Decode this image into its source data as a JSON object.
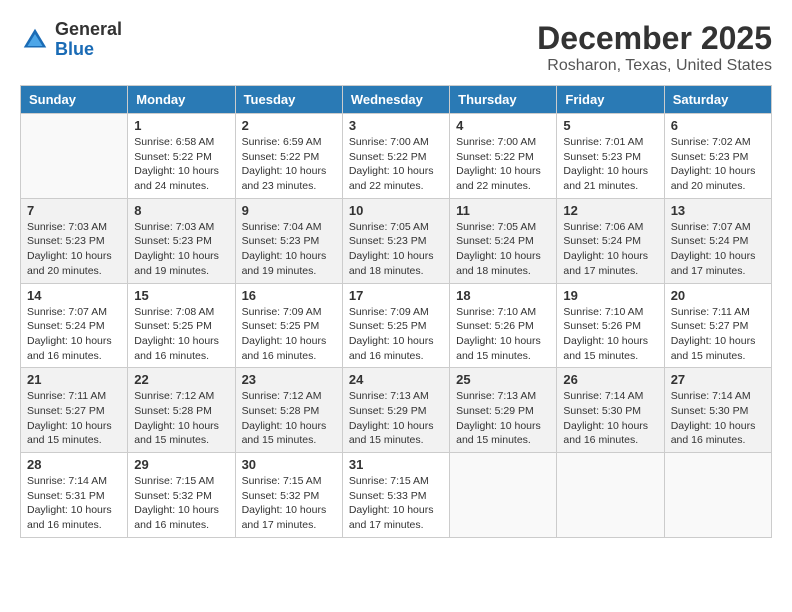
{
  "logo": {
    "general": "General",
    "blue": "Blue"
  },
  "title": "December 2025",
  "location": "Rosharon, Texas, United States",
  "headers": [
    "Sunday",
    "Monday",
    "Tuesday",
    "Wednesday",
    "Thursday",
    "Friday",
    "Saturday"
  ],
  "weeks": [
    [
      {
        "day": "",
        "sunrise": "",
        "sunset": "",
        "daylight": ""
      },
      {
        "day": "1",
        "sunrise": "Sunrise: 6:58 AM",
        "sunset": "Sunset: 5:22 PM",
        "daylight": "Daylight: 10 hours and 24 minutes."
      },
      {
        "day": "2",
        "sunrise": "Sunrise: 6:59 AM",
        "sunset": "Sunset: 5:22 PM",
        "daylight": "Daylight: 10 hours and 23 minutes."
      },
      {
        "day": "3",
        "sunrise": "Sunrise: 7:00 AM",
        "sunset": "Sunset: 5:22 PM",
        "daylight": "Daylight: 10 hours and 22 minutes."
      },
      {
        "day": "4",
        "sunrise": "Sunrise: 7:00 AM",
        "sunset": "Sunset: 5:22 PM",
        "daylight": "Daylight: 10 hours and 22 minutes."
      },
      {
        "day": "5",
        "sunrise": "Sunrise: 7:01 AM",
        "sunset": "Sunset: 5:23 PM",
        "daylight": "Daylight: 10 hours and 21 minutes."
      },
      {
        "day": "6",
        "sunrise": "Sunrise: 7:02 AM",
        "sunset": "Sunset: 5:23 PM",
        "daylight": "Daylight: 10 hours and 20 minutes."
      }
    ],
    [
      {
        "day": "7",
        "sunrise": "Sunrise: 7:03 AM",
        "sunset": "Sunset: 5:23 PM",
        "daylight": "Daylight: 10 hours and 20 minutes."
      },
      {
        "day": "8",
        "sunrise": "Sunrise: 7:03 AM",
        "sunset": "Sunset: 5:23 PM",
        "daylight": "Daylight: 10 hours and 19 minutes."
      },
      {
        "day": "9",
        "sunrise": "Sunrise: 7:04 AM",
        "sunset": "Sunset: 5:23 PM",
        "daylight": "Daylight: 10 hours and 19 minutes."
      },
      {
        "day": "10",
        "sunrise": "Sunrise: 7:05 AM",
        "sunset": "Sunset: 5:23 PM",
        "daylight": "Daylight: 10 hours and 18 minutes."
      },
      {
        "day": "11",
        "sunrise": "Sunrise: 7:05 AM",
        "sunset": "Sunset: 5:24 PM",
        "daylight": "Daylight: 10 hours and 18 minutes."
      },
      {
        "day": "12",
        "sunrise": "Sunrise: 7:06 AM",
        "sunset": "Sunset: 5:24 PM",
        "daylight": "Daylight: 10 hours and 17 minutes."
      },
      {
        "day": "13",
        "sunrise": "Sunrise: 7:07 AM",
        "sunset": "Sunset: 5:24 PM",
        "daylight": "Daylight: 10 hours and 17 minutes."
      }
    ],
    [
      {
        "day": "14",
        "sunrise": "Sunrise: 7:07 AM",
        "sunset": "Sunset: 5:24 PM",
        "daylight": "Daylight: 10 hours and 16 minutes."
      },
      {
        "day": "15",
        "sunrise": "Sunrise: 7:08 AM",
        "sunset": "Sunset: 5:25 PM",
        "daylight": "Daylight: 10 hours and 16 minutes."
      },
      {
        "day": "16",
        "sunrise": "Sunrise: 7:09 AM",
        "sunset": "Sunset: 5:25 PM",
        "daylight": "Daylight: 10 hours and 16 minutes."
      },
      {
        "day": "17",
        "sunrise": "Sunrise: 7:09 AM",
        "sunset": "Sunset: 5:25 PM",
        "daylight": "Daylight: 10 hours and 16 minutes."
      },
      {
        "day": "18",
        "sunrise": "Sunrise: 7:10 AM",
        "sunset": "Sunset: 5:26 PM",
        "daylight": "Daylight: 10 hours and 15 minutes."
      },
      {
        "day": "19",
        "sunrise": "Sunrise: 7:10 AM",
        "sunset": "Sunset: 5:26 PM",
        "daylight": "Daylight: 10 hours and 15 minutes."
      },
      {
        "day": "20",
        "sunrise": "Sunrise: 7:11 AM",
        "sunset": "Sunset: 5:27 PM",
        "daylight": "Daylight: 10 hours and 15 minutes."
      }
    ],
    [
      {
        "day": "21",
        "sunrise": "Sunrise: 7:11 AM",
        "sunset": "Sunset: 5:27 PM",
        "daylight": "Daylight: 10 hours and 15 minutes."
      },
      {
        "day": "22",
        "sunrise": "Sunrise: 7:12 AM",
        "sunset": "Sunset: 5:28 PM",
        "daylight": "Daylight: 10 hours and 15 minutes."
      },
      {
        "day": "23",
        "sunrise": "Sunrise: 7:12 AM",
        "sunset": "Sunset: 5:28 PM",
        "daylight": "Daylight: 10 hours and 15 minutes."
      },
      {
        "day": "24",
        "sunrise": "Sunrise: 7:13 AM",
        "sunset": "Sunset: 5:29 PM",
        "daylight": "Daylight: 10 hours and 15 minutes."
      },
      {
        "day": "25",
        "sunrise": "Sunrise: 7:13 AM",
        "sunset": "Sunset: 5:29 PM",
        "daylight": "Daylight: 10 hours and 15 minutes."
      },
      {
        "day": "26",
        "sunrise": "Sunrise: 7:14 AM",
        "sunset": "Sunset: 5:30 PM",
        "daylight": "Daylight: 10 hours and 16 minutes."
      },
      {
        "day": "27",
        "sunrise": "Sunrise: 7:14 AM",
        "sunset": "Sunset: 5:30 PM",
        "daylight": "Daylight: 10 hours and 16 minutes."
      }
    ],
    [
      {
        "day": "28",
        "sunrise": "Sunrise: 7:14 AM",
        "sunset": "Sunset: 5:31 PM",
        "daylight": "Daylight: 10 hours and 16 minutes."
      },
      {
        "day": "29",
        "sunrise": "Sunrise: 7:15 AM",
        "sunset": "Sunset: 5:32 PM",
        "daylight": "Daylight: 10 hours and 16 minutes."
      },
      {
        "day": "30",
        "sunrise": "Sunrise: 7:15 AM",
        "sunset": "Sunset: 5:32 PM",
        "daylight": "Daylight: 10 hours and 17 minutes."
      },
      {
        "day": "31",
        "sunrise": "Sunrise: 7:15 AM",
        "sunset": "Sunset: 5:33 PM",
        "daylight": "Daylight: 10 hours and 17 minutes."
      },
      {
        "day": "",
        "sunrise": "",
        "sunset": "",
        "daylight": ""
      },
      {
        "day": "",
        "sunrise": "",
        "sunset": "",
        "daylight": ""
      },
      {
        "day": "",
        "sunrise": "",
        "sunset": "",
        "daylight": ""
      }
    ]
  ]
}
